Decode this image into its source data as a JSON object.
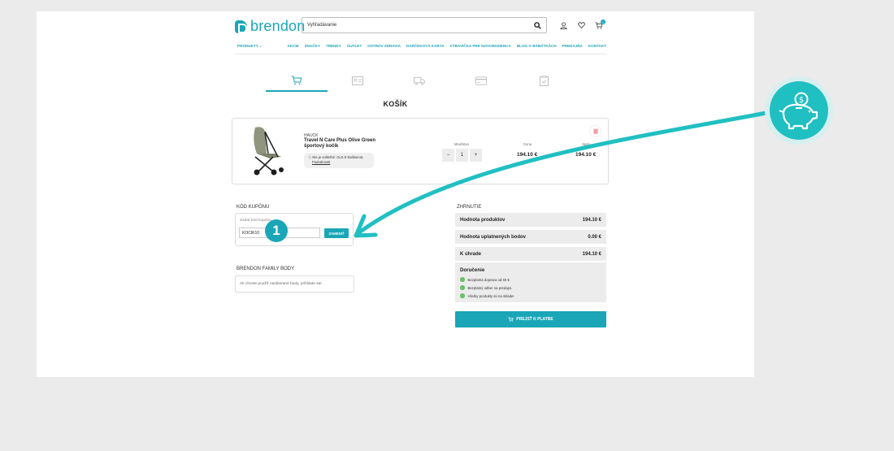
{
  "header": {
    "logo": "brendon",
    "search_placeholder": "Vyhľadávanie",
    "cart_count": "1"
  },
  "nav": [
    "PRODUKTY ⌵",
    "AKCIE",
    "ZNAČKY",
    "TRENDY",
    "OUTLET",
    "OSTROV ZDRAVIA",
    "DARČEKOVÁ KARTA",
    "VÝBAVIČKA PRE NOVORODENCA",
    "BLOG O BÁBÄTKÁCH",
    "PREDAJŇA",
    "KONTAKT"
  ],
  "cart": {
    "title": "KOŠÍK",
    "item": {
      "brand": "HAUCK",
      "name": "Travel N Care Plus Olive Green športový kočík",
      "note": "Nie je voliteľné: GLS E-balíkomat,",
      "note_link": "Podrobnosti",
      "qty_label": "Množstvo",
      "qty": "1",
      "price_label": "Cena",
      "price": "194.10 €",
      "total_label": "Spolu",
      "total": "194.10 €"
    }
  },
  "coupon": {
    "title": "KÓD KUPÓNU",
    "placeholder": "Zadať kód kupónu",
    "value": "KOCIK10",
    "button": "ZAMENIŤ",
    "badge": "1"
  },
  "family": {
    "title": "BRENDON FAMILY BODY",
    "text": "Ak chcete použiť nazbierané body, prihláste sa!"
  },
  "summary": {
    "title": "ZHRNUTIE",
    "rows": [
      {
        "label": "Hodnota produktov",
        "value": "194.10 €"
      },
      {
        "label": "Hodnota uplatnených bodov",
        "value": "0.00 €"
      },
      {
        "label": "K úhrade",
        "value": "194.10 €"
      }
    ],
    "delivery_title": "Doručenie",
    "delivery_items": [
      "Bezplatná doprava od 60 €",
      "Bezplatný odber na predajni.",
      "Všetky produkty sú na sklade!"
    ],
    "pay_button": "PREJSŤ K PLATBE"
  },
  "colors": {
    "accent": "#1aa6b7",
    "overlay": "#20bfc2",
    "check": "#6cbf6a"
  }
}
